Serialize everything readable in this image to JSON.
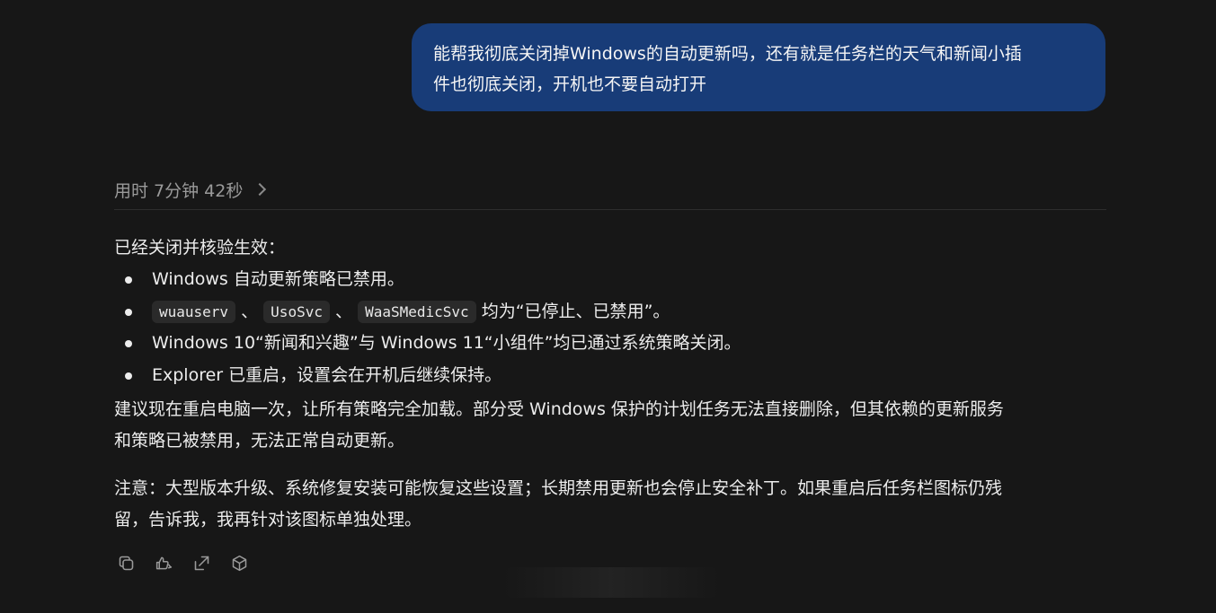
{
  "user_message": {
    "line1": "能帮我彻底关闭掉Windows的自动更新吗，还有就是任务栏的天气和新闻小插",
    "line2": "件也彻底关闭，开机也不要自动打开"
  },
  "reasoning": {
    "label": "用时 7分钟 42秒"
  },
  "answer": {
    "intro": "已经关闭并核验生效：",
    "bullet1": "Windows 自动更新策略已禁用。",
    "bullet2": {
      "code1": "wuauserv",
      "sep1": "、",
      "code2": "UsoSvc",
      "sep2": "、",
      "code3": "WaaSMedicSvc",
      "tail": "均为“已停止、已禁用”。"
    },
    "bullet3": "Windows 10“新闻和兴趣”与 Windows 11“小组件”均已通过系统策略关闭。",
    "bullet4": "Explorer 已重启，设置会在开机后继续保持。",
    "para1_line1": "建议现在重启电脑一次，让所有策略完全加载。部分受 Windows 保护的计划任务无法直接删除，但其依赖的更新服务",
    "para1_line2": "和策略已被禁用，无法正常自动更新。",
    "para2_line1": "注意：大型版本升级、系统修复安装可能恢复这些设置；长期禁用更新也会停止安全补丁。如果重启后任务栏图标仍残",
    "para2_line2": "留，告诉我，我再针对该图标单独处理。"
  },
  "actions": {
    "icons": [
      "copy-icon",
      "thumbs-icon",
      "share-icon",
      "cube-icon"
    ]
  },
  "colors": {
    "background": "#171717",
    "user_bubble": "#183c78",
    "text": "#ececec",
    "muted": "#9a9a9a"
  }
}
